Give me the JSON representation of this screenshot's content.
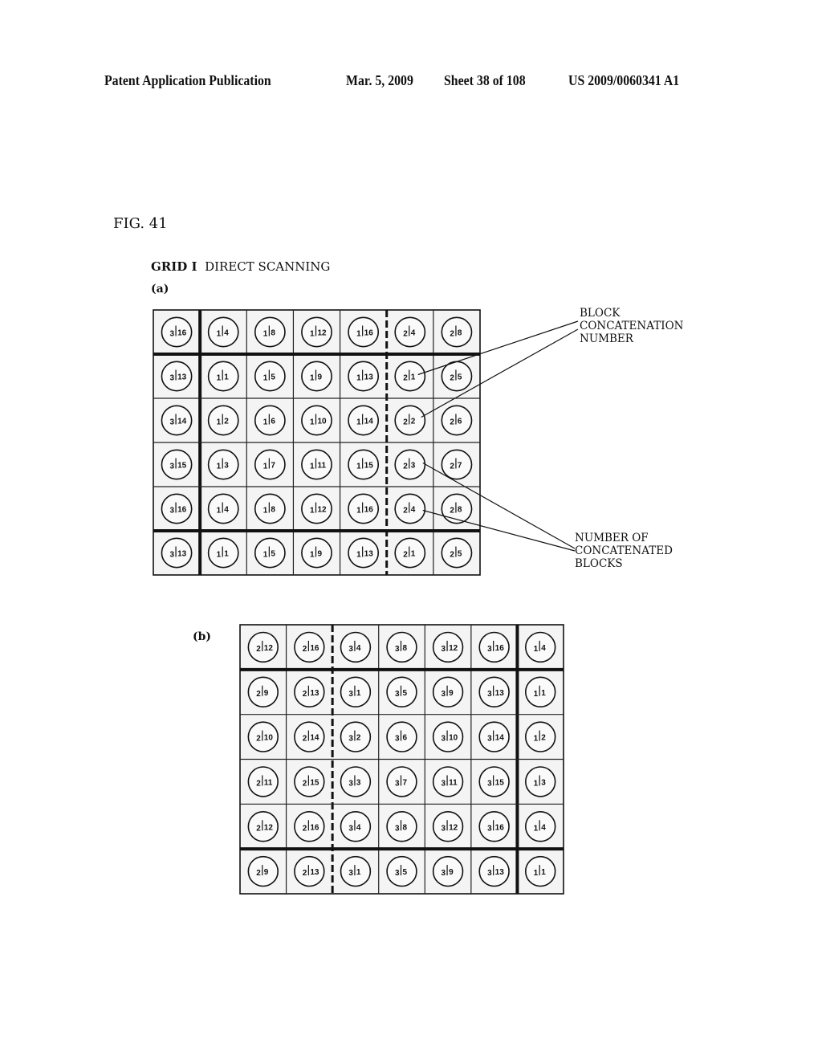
{
  "header": {
    "publication": "Patent Application Publication",
    "date": "Mar. 5, 2009",
    "sheet": "Sheet 38 of 108",
    "number": "US 2009/0060341 A1"
  },
  "figure": {
    "label": "FIG. 41",
    "grid_name": "GRID I",
    "scan_mode": "DIRECT SCANNING"
  },
  "panel_a": {
    "label": "(a)",
    "cells": [
      [
        [
          "3",
          "16"
        ],
        [
          "1",
          "4"
        ],
        [
          "1",
          "8"
        ],
        [
          "1",
          "12"
        ],
        [
          "1",
          "16"
        ],
        [
          "2",
          "4"
        ],
        [
          "2",
          "8"
        ]
      ],
      [
        [
          "3",
          "13"
        ],
        [
          "1",
          "1"
        ],
        [
          "1",
          "5"
        ],
        [
          "1",
          "9"
        ],
        [
          "1",
          "13"
        ],
        [
          "2",
          "1"
        ],
        [
          "2",
          "5"
        ]
      ],
      [
        [
          "3",
          "14"
        ],
        [
          "1",
          "2"
        ],
        [
          "1",
          "6"
        ],
        [
          "1",
          "10"
        ],
        [
          "1",
          "14"
        ],
        [
          "2",
          "2"
        ],
        [
          "2",
          "6"
        ]
      ],
      [
        [
          "3",
          "15"
        ],
        [
          "1",
          "3"
        ],
        [
          "1",
          "7"
        ],
        [
          "1",
          "11"
        ],
        [
          "1",
          "15"
        ],
        [
          "2",
          "3"
        ],
        [
          "2",
          "7"
        ]
      ],
      [
        [
          "3",
          "16"
        ],
        [
          "1",
          "4"
        ],
        [
          "1",
          "8"
        ],
        [
          "1",
          "12"
        ],
        [
          "1",
          "16"
        ],
        [
          "2",
          "4"
        ],
        [
          "2",
          "8"
        ]
      ],
      [
        [
          "3",
          "13"
        ],
        [
          "1",
          "1"
        ],
        [
          "1",
          "5"
        ],
        [
          "1",
          "9"
        ],
        [
          "1",
          "13"
        ],
        [
          "2",
          "1"
        ],
        [
          "2",
          "5"
        ]
      ]
    ],
    "annotations": {
      "block_concatenation_number": "BLOCK\nCONCATENATION\nNUMBER",
      "number_of_concatenated_blocks": "NUMBER OF\nCONCATENATED\nBLOCKS"
    }
  },
  "panel_b": {
    "label": "(b)",
    "cells": [
      [
        [
          "2",
          "12"
        ],
        [
          "2",
          "16"
        ],
        [
          "3",
          "4"
        ],
        [
          "3",
          "8"
        ],
        [
          "3",
          "12"
        ],
        [
          "3",
          "16"
        ],
        [
          "1",
          "4"
        ]
      ],
      [
        [
          "2",
          "9"
        ],
        [
          "2",
          "13"
        ],
        [
          "3",
          "1"
        ],
        [
          "3",
          "5"
        ],
        [
          "3",
          "9"
        ],
        [
          "3",
          "13"
        ],
        [
          "1",
          "1"
        ]
      ],
      [
        [
          "2",
          "10"
        ],
        [
          "2",
          "14"
        ],
        [
          "3",
          "2"
        ],
        [
          "3",
          "6"
        ],
        [
          "3",
          "10"
        ],
        [
          "3",
          "14"
        ],
        [
          "1",
          "2"
        ]
      ],
      [
        [
          "2",
          "11"
        ],
        [
          "2",
          "15"
        ],
        [
          "3",
          "3"
        ],
        [
          "3",
          "7"
        ],
        [
          "3",
          "11"
        ],
        [
          "3",
          "15"
        ],
        [
          "1",
          "3"
        ]
      ],
      [
        [
          "2",
          "12"
        ],
        [
          "2",
          "16"
        ],
        [
          "3",
          "4"
        ],
        [
          "3",
          "8"
        ],
        [
          "3",
          "12"
        ],
        [
          "3",
          "16"
        ],
        [
          "1",
          "4"
        ]
      ],
      [
        [
          "2",
          "9"
        ],
        [
          "2",
          "13"
        ],
        [
          "3",
          "1"
        ],
        [
          "3",
          "5"
        ],
        [
          "3",
          "9"
        ],
        [
          "3",
          "13"
        ],
        [
          "1",
          "1"
        ]
      ]
    ]
  }
}
